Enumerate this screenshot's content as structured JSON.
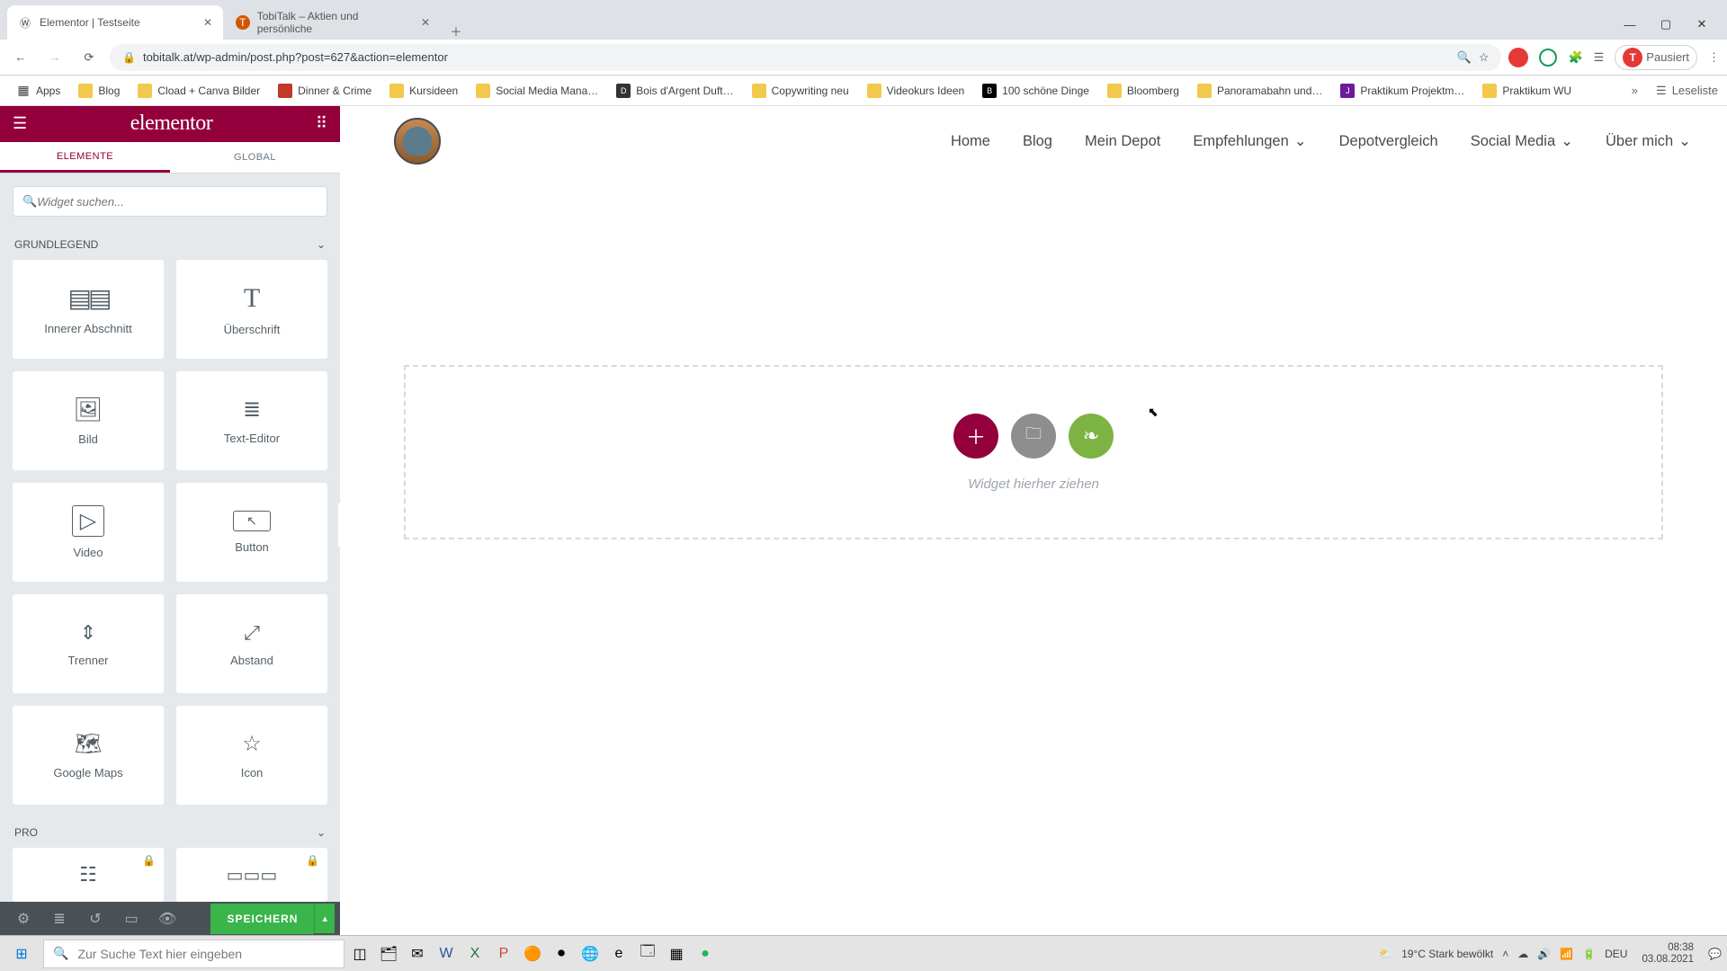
{
  "browser": {
    "tabs": [
      {
        "title": "Elementor | Testseite",
        "active": true,
        "fav": "W"
      },
      {
        "title": "TobiTalk – Aktien und persönliche",
        "active": false,
        "fav": "T"
      }
    ],
    "url": "tobitalk.at/wp-admin/post.php?post=627&action=elementor",
    "profile_label": "Pausiert",
    "bookmarks": [
      "Apps",
      "Blog",
      "Cload + Canva Bilder",
      "Dinner & Crime",
      "Kursideen",
      "Social Media Mana…",
      "Bois d'Argent Duft…",
      "Copywriting neu",
      "Videokurs Ideen",
      "100 schöne Dinge",
      "Bloomberg",
      "Panoramabahn und…",
      "Praktikum Projektm…",
      "Praktikum WU"
    ],
    "readlist": "Leseliste"
  },
  "panel": {
    "brand": "elementor",
    "tab_elemente": "ELEMENTE",
    "tab_global": "GLOBAL",
    "search_placeholder": "Widget suchen...",
    "cat_basic": "GRUNDLEGEND",
    "cat_pro": "PRO",
    "widgets": [
      {
        "label": "Innerer Abschnitt"
      },
      {
        "label": "Überschrift"
      },
      {
        "label": "Bild"
      },
      {
        "label": "Text-Editor"
      },
      {
        "label": "Video"
      },
      {
        "label": "Button"
      },
      {
        "label": "Trenner"
      },
      {
        "label": "Abstand"
      },
      {
        "label": "Google Maps"
      },
      {
        "label": "Icon"
      }
    ],
    "save": "SPEICHERN"
  },
  "site_nav": [
    "Home",
    "Blog",
    "Mein Depot",
    "Empfehlungen",
    "Depotvergleich",
    "Social Media",
    "Über mich"
  ],
  "dropzone_text": "Widget hierher ziehen",
  "taskbar": {
    "search_placeholder": "Zur Suche Text hier eingeben",
    "weather": "19°C  Stark bewölkt",
    "lang": "DEU",
    "time": "08:38",
    "date": "03.08.2021"
  }
}
